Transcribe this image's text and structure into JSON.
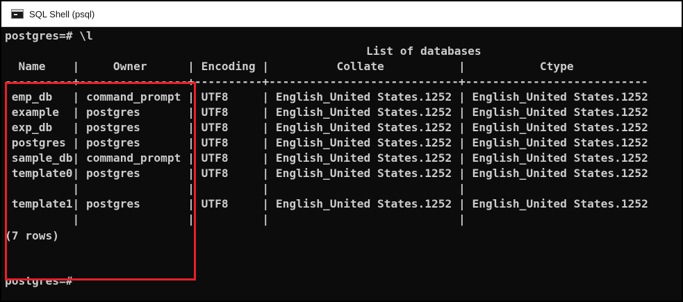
{
  "window": {
    "title": "SQL Shell (psql)",
    "icon": "terminal-icon"
  },
  "console": {
    "command_line": "postgres=# \\l",
    "table_title": "List of databases",
    "header_line": "  Name    |     Owner      | Encoding |          Collate           |           Ctype           ",
    "separator_line": "----------+----------------+----------+----------------------------+---------------------------",
    "columns": [
      "Name",
      "Owner",
      "Encoding",
      "Collate",
      "Ctype"
    ],
    "rows": [
      " emp_db   | command_prompt | UTF8     | English_United States.1252 | English_United States.1252",
      " example  | postgres       | UTF8     | English_United States.1252 | English_United States.1252",
      " exp_db   | postgres       | UTF8     | English_United States.1252 | English_United States.1252",
      " postgres | postgres       | UTF8     | English_United States.1252 | English_United States.1252",
      " sample_db| command_prompt | UTF8     | English_United States.1252 | English_United States.1252",
      " template0| postgres       | UTF8     | English_United States.1252 | English_United States.1252",
      "          |                |          |                            |",
      " template1| postgres       | UTF8     | English_United States.1252 | English_United States.1252",
      "          |                |          |                            |"
    ],
    "row_count": "(7 rows)",
    "prompt": "postgres=#"
  },
  "colors": {
    "background": "#0c0c0c",
    "text": "#cccccc",
    "highlight": "#e8202a"
  }
}
